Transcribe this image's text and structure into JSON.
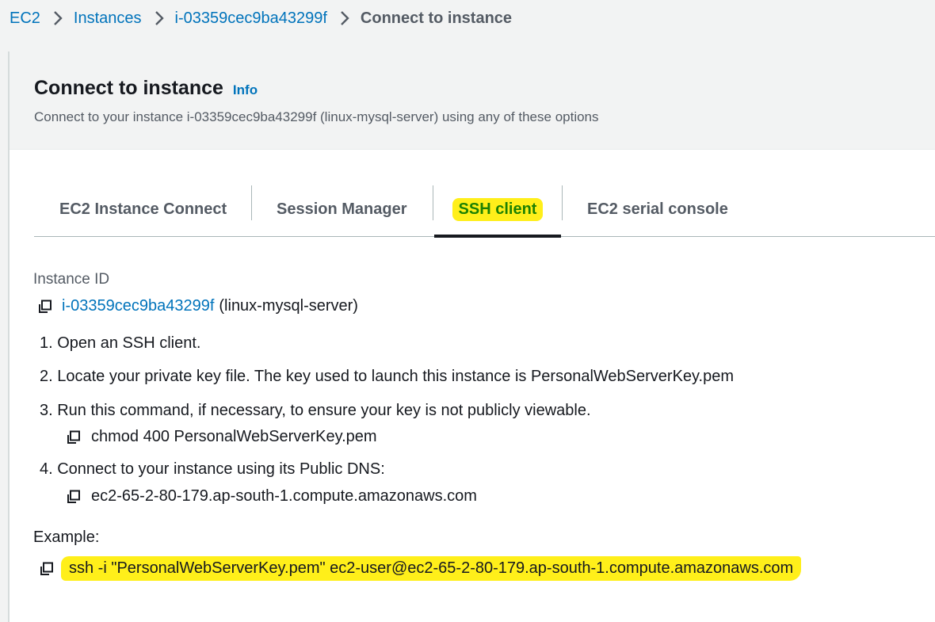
{
  "breadcrumb": {
    "items": [
      "EC2",
      "Instances",
      "i-03359cec9ba43299f"
    ],
    "current": "Connect to instance"
  },
  "header": {
    "title": "Connect to instance",
    "info": "Info",
    "description": "Connect to your instance i-03359cec9ba43299f (linux-mysql-server) using any of these options"
  },
  "tabs": [
    {
      "label": "EC2 Instance Connect"
    },
    {
      "label": "Session Manager"
    },
    {
      "label": "SSH client",
      "active": true
    },
    {
      "label": "EC2 serial console"
    }
  ],
  "instance": {
    "label": "Instance ID",
    "id": "i-03359cec9ba43299f",
    "name": "(linux-mysql-server)"
  },
  "steps": [
    {
      "text": "1. Open an SSH client."
    },
    {
      "text": "2. Locate your private key file. The key used to launch this instance is PersonalWebServerKey.pem"
    },
    {
      "text": "3. Run this command, if necessary, to ensure your key is not publicly viewable.",
      "command": "chmod 400 PersonalWebServerKey.pem"
    },
    {
      "text": "4. Connect to your instance using its Public DNS:",
      "command": "ec2-65-2-80-179.ap-south-1.compute.amazonaws.com"
    }
  ],
  "example": {
    "label": "Example:",
    "command": "ssh -i \"PersonalWebServerKey.pem\" ec2-user@ec2-65-2-80-179.ap-south-1.compute.amazonaws.com"
  },
  "colors": {
    "link": "#0073bb",
    "highlight": "#ffef1a",
    "active_tab_text": "#1d8102",
    "background": "#f2f3f3"
  },
  "icons": [
    "chevron-right-icon",
    "copy-icon"
  ]
}
